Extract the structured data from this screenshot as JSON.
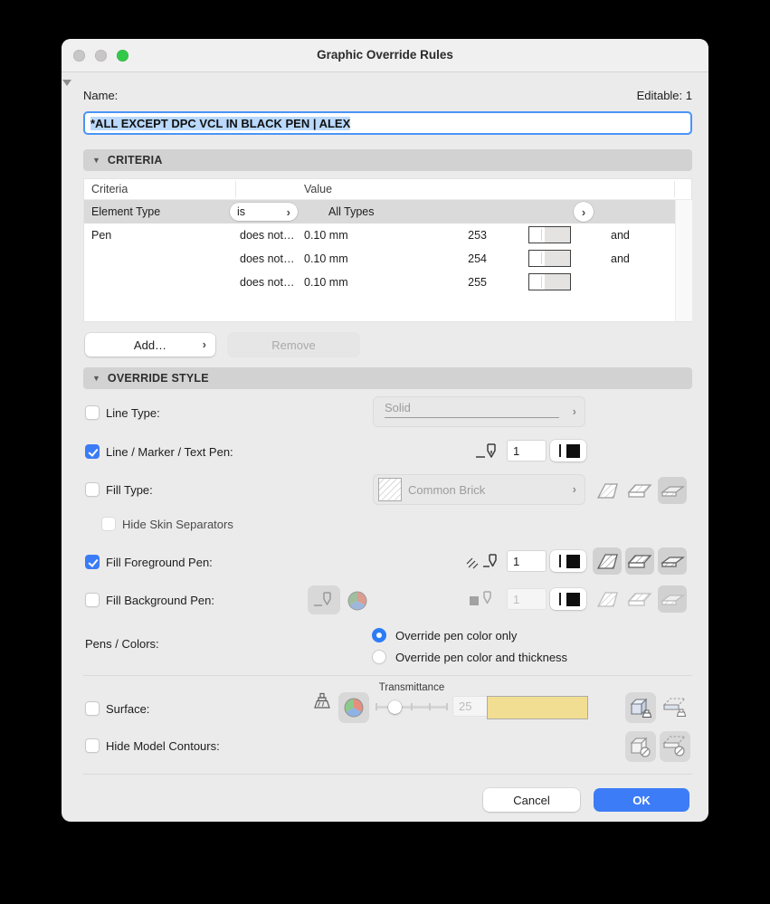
{
  "window": {
    "title": "Graphic Override Rules"
  },
  "name": {
    "label": "Name:",
    "editable": "Editable: 1",
    "value": "*ALL EXCEPT DPC VCL IN BLACK PEN | ALEX"
  },
  "criteria": {
    "title": "CRITERIA",
    "col_criteria": "Criteria",
    "col_value": "Value",
    "row_element": {
      "criteria": "Element Type",
      "operator": "is",
      "value": "All Types"
    },
    "pen_rows": [
      {
        "criteria": "Pen",
        "operator": "does not…",
        "value": "0.10 mm",
        "pen": "253",
        "conj": "and"
      },
      {
        "criteria": "",
        "operator": "does not…",
        "value": "0.10 mm",
        "pen": "254",
        "conj": "and"
      },
      {
        "criteria": "",
        "operator": "does not…",
        "value": "0.10 mm",
        "pen": "255",
        "conj": ""
      }
    ],
    "add": "Add…",
    "remove": "Remove"
  },
  "override": {
    "title": "OVERRIDE STYLE",
    "line_type": {
      "label": "Line Type:",
      "value": "Solid",
      "checked": false
    },
    "line_pen": {
      "label": "Line / Marker / Text Pen:",
      "value": "1",
      "checked": true
    },
    "fill_type": {
      "label": "Fill Type:",
      "value": "Common Brick",
      "checked": false
    },
    "hide_skin": {
      "label": "Hide Skin Separators",
      "checked": false
    },
    "fill_fg": {
      "label": "Fill Foreground Pen:",
      "value": "1",
      "checked": true
    },
    "fill_bg": {
      "label": "Fill Background Pen:",
      "value": "1",
      "checked": false
    },
    "pens_colors": {
      "label": "Pens / Colors:",
      "option1": "Override pen color only",
      "option2": "Override pen color and thickness",
      "selected": "Override pen color only"
    },
    "surface": {
      "label": "Surface:",
      "trans_label": "Transmittance",
      "trans_value": "25",
      "swatch_color": "#F2DE92",
      "checked": false
    },
    "hide_contours": {
      "label": "Hide Model Contours:",
      "checked": false
    }
  },
  "footer": {
    "cancel": "Cancel",
    "ok": "OK"
  },
  "colors": {
    "accent": "#3B7CF6",
    "selection": "#BAD9FC",
    "section_bar": "#D3D2D2"
  }
}
